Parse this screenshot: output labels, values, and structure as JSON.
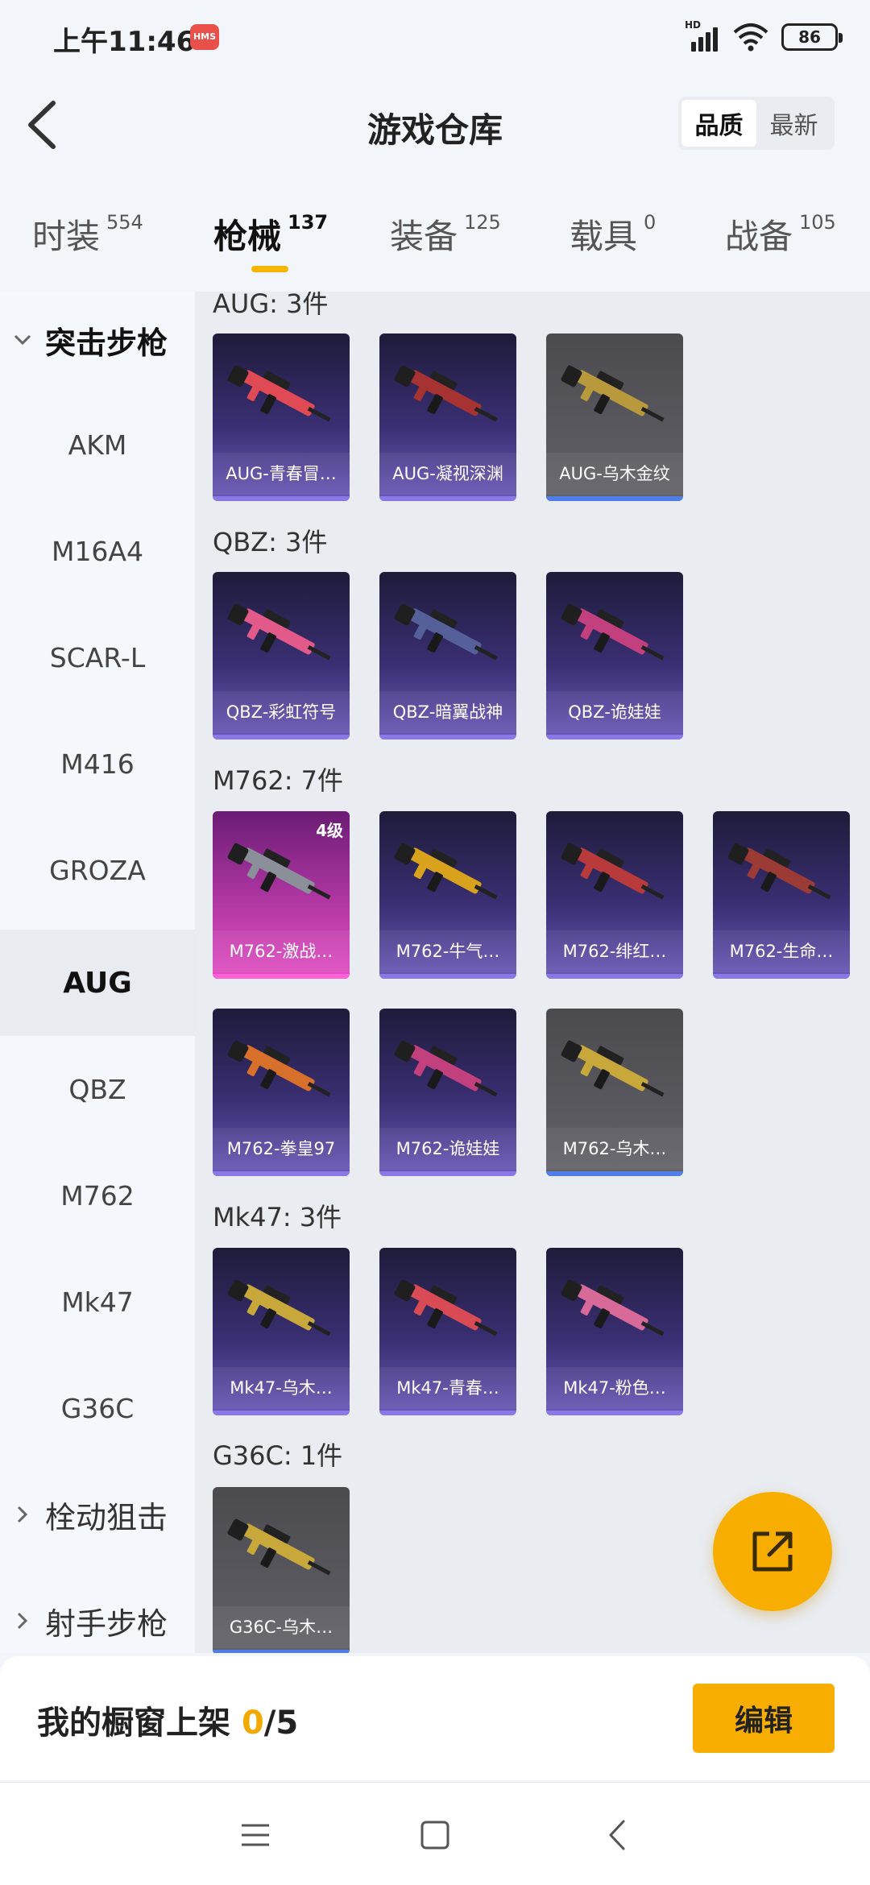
{
  "status_bar": {
    "time": "上午11:46",
    "badge": "HMS",
    "network": "HD",
    "battery": "86"
  },
  "header": {
    "title": "游戏仓库",
    "sort_options": [
      "品质",
      "最新"
    ],
    "active_sort": "品质"
  },
  "tabs": [
    {
      "label": "时装",
      "count": "554"
    },
    {
      "label": "枪械",
      "count": "137"
    },
    {
      "label": "装备",
      "count": "125"
    },
    {
      "label": "载具",
      "count": "0"
    },
    {
      "label": "战备",
      "count": "105"
    }
  ],
  "active_tab": "枪械",
  "sidebar": {
    "categories": [
      {
        "label": "突击步枪",
        "expanded": true
      },
      {
        "label": "栓动狙击",
        "expanded": false
      },
      {
        "label": "射手步枪",
        "expanded": false
      }
    ],
    "items": [
      "AKM",
      "M16A4",
      "SCAR-L",
      "M416",
      "GROZA",
      "AUG",
      "QBZ",
      "M762",
      "Mk47",
      "G36C"
    ],
    "active_item": "AUG"
  },
  "groups": [
    {
      "title": "AUG: 3件",
      "items": [
        {
          "name": "AUG-青春冒…",
          "rarity": "purple",
          "gun_color": "#e04a54"
        },
        {
          "name": "AUG-凝视深渊",
          "rarity": "purple",
          "gun_color": "#a63232"
        },
        {
          "name": "AUG-乌木金纹",
          "rarity": "gray",
          "gun_color": "#b89a3c"
        }
      ]
    },
    {
      "title": "QBZ: 3件",
      "items": [
        {
          "name": "QBZ-彩虹符号",
          "rarity": "purple",
          "gun_color": "#e25a8a"
        },
        {
          "name": "QBZ-暗翼战神",
          "rarity": "purple",
          "gun_color": "#55609a"
        },
        {
          "name": "QBZ-诡娃娃",
          "rarity": "purple",
          "gun_color": "#c2407e"
        }
      ]
    },
    {
      "title": "M762: 7件",
      "items": [
        {
          "name": "M762-激战…",
          "rarity": "pink",
          "gun_color": "#8a8f9a",
          "level": "4级"
        },
        {
          "name": "M762-牛气…",
          "rarity": "purple",
          "gun_color": "#d9a21c"
        },
        {
          "name": "M762-绯红…",
          "rarity": "purple",
          "gun_color": "#b83a3a"
        },
        {
          "name": "M762-生命…",
          "rarity": "purple",
          "gun_color": "#9c3a36"
        },
        {
          "name": "M762-拳皇97",
          "rarity": "purple",
          "gun_color": "#d8702c"
        },
        {
          "name": "M762-诡娃娃",
          "rarity": "purple",
          "gun_color": "#c2407e"
        },
        {
          "name": "M762-乌木…",
          "rarity": "gray",
          "gun_color": "#c8a83a"
        }
      ]
    },
    {
      "title": "Mk47: 3件",
      "items": [
        {
          "name": "Mk47-乌木…",
          "rarity": "purple",
          "gun_color": "#c8a83a"
        },
        {
          "name": "Mk47-青春…",
          "rarity": "purple",
          "gun_color": "#d84a54"
        },
        {
          "name": "Mk47-粉色…",
          "rarity": "purple",
          "gun_color": "#d86a9a"
        }
      ]
    },
    {
      "title": "G36C: 1件",
      "items": [
        {
          "name": "G36C-乌木…",
          "rarity": "gray",
          "gun_color": "#c8a83a"
        }
      ]
    }
  ],
  "bottom_bar": {
    "showcase_label": "我的橱窗上架",
    "current": "0",
    "total": "/5",
    "edit_label": "编辑"
  },
  "colors": {
    "accent": "#f7ae00",
    "rarity_purple": "#6b59b9",
    "rarity_pink": "#e14fc2",
    "rarity_gray": "#5a5a60"
  }
}
